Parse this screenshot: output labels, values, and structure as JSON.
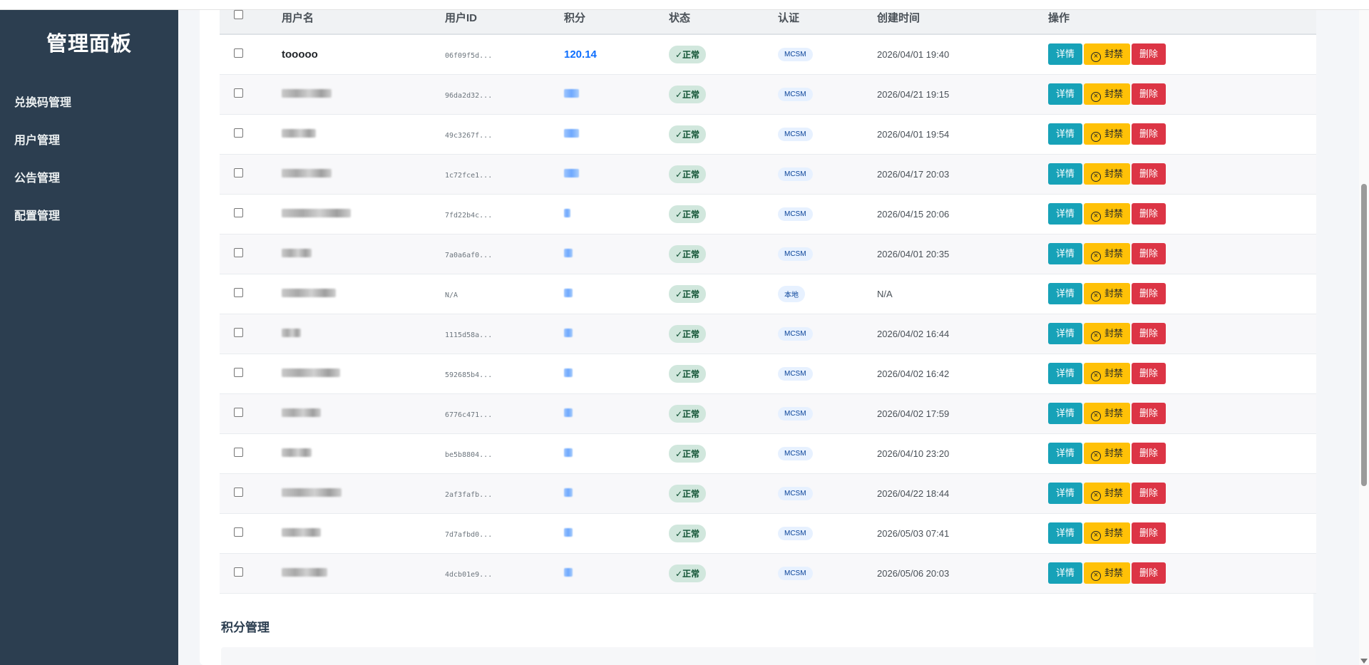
{
  "sidebar": {
    "title": "管理面板",
    "items": [
      {
        "label": "兑换码管理"
      },
      {
        "label": "用户管理"
      },
      {
        "label": "公告管理"
      },
      {
        "label": "配置管理"
      }
    ]
  },
  "table": {
    "headers": {
      "username": "用户名",
      "user_id": "用户ID",
      "points": "积分",
      "status": "状态",
      "auth": "认证",
      "created": "创建时间",
      "actions": "操作"
    },
    "rows": [
      {
        "username": "tooooo",
        "user_id": "06f09f5d...",
        "points": "120.14",
        "status": "✓正常",
        "auth": "MCSM",
        "created": "2026/04/01 19:40"
      },
      {
        "username": "",
        "user_id": "96da2d32...",
        "points": "",
        "status": "✓正常",
        "auth": "MCSM",
        "created": "2026/04/21 19:15"
      },
      {
        "username": "",
        "user_id": "49c3267f...",
        "points": "",
        "status": "✓正常",
        "auth": "MCSM",
        "created": "2026/04/01 19:54"
      },
      {
        "username": "",
        "user_id": "1c72fce1...",
        "points": "",
        "status": "✓正常",
        "auth": "MCSM",
        "created": "2026/04/17 20:03"
      },
      {
        "username": "",
        "user_id": "7fd22b4c...",
        "points": "",
        "status": "✓正常",
        "auth": "MCSM",
        "created": "2026/04/15 20:06"
      },
      {
        "username": "",
        "user_id": "7a0a6af0...",
        "points": "",
        "status": "✓正常",
        "auth": "MCSM",
        "created": "2026/04/01 20:35"
      },
      {
        "username": "",
        "user_id": "N/A",
        "points": "",
        "status": "✓正常",
        "auth": "本地",
        "created": "N/A"
      },
      {
        "username": "",
        "user_id": "1115d58a...",
        "points": "",
        "status": "✓正常",
        "auth": "MCSM",
        "created": "2026/04/02 16:44"
      },
      {
        "username": "",
        "user_id": "592685b4...",
        "points": "",
        "status": "✓正常",
        "auth": "MCSM",
        "created": "2026/04/02 16:42"
      },
      {
        "username": "",
        "user_id": "6776c471...",
        "points": "",
        "status": "✓正常",
        "auth": "MCSM",
        "created": "2026/04/02 17:59"
      },
      {
        "username": "",
        "user_id": "be5b8804...",
        "points": "",
        "status": "✓正常",
        "auth": "MCSM",
        "created": "2026/04/10 23:20"
      },
      {
        "username": "",
        "user_id": "2af3fafb...",
        "points": "",
        "status": "✓正常",
        "auth": "MCSM",
        "created": "2026/04/22 18:44"
      },
      {
        "username": "",
        "user_id": "7d7afbd0...",
        "points": "",
        "status": "✓正常",
        "auth": "MCSM",
        "created": "2026/05/03 07:41"
      },
      {
        "username": "",
        "user_id": "4dcb01e9...",
        "points": "",
        "status": "✓正常",
        "auth": "MCSM",
        "created": "2026/05/06 20:03"
      }
    ],
    "actions": {
      "detail": "详情",
      "ban": "封禁",
      "delete": "删除"
    }
  },
  "points_section": {
    "title": "积分管理"
  }
}
